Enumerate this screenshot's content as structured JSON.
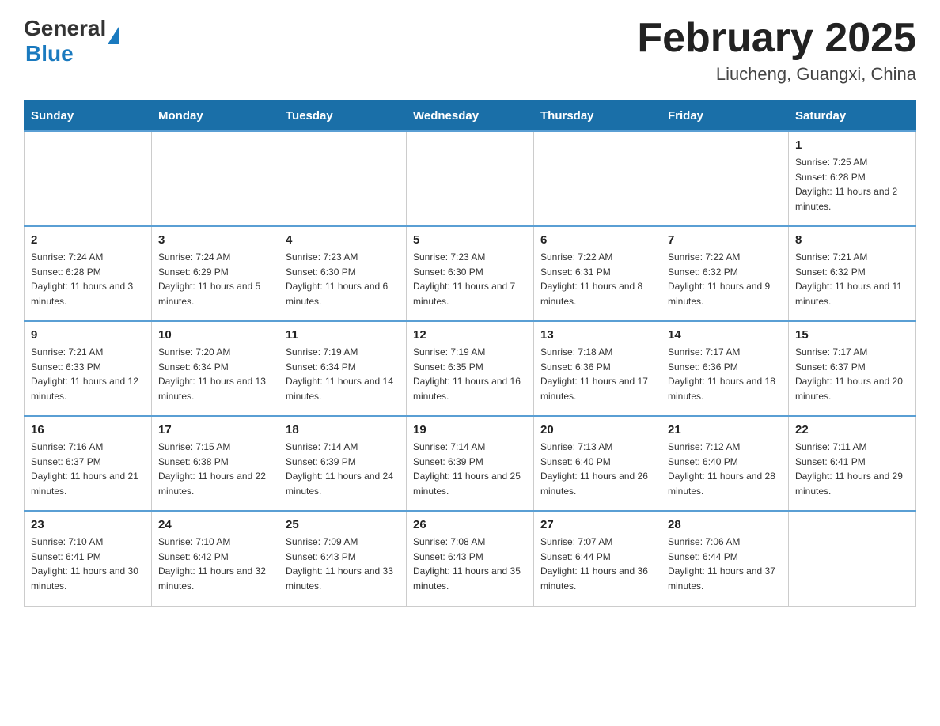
{
  "header": {
    "logo": {
      "general": "General",
      "blue": "Blue"
    },
    "title": "February 2025",
    "location": "Liucheng, Guangxi, China"
  },
  "weekdays": [
    "Sunday",
    "Monday",
    "Tuesday",
    "Wednesday",
    "Thursday",
    "Friday",
    "Saturday"
  ],
  "weeks": [
    [
      {
        "day": "",
        "info": ""
      },
      {
        "day": "",
        "info": ""
      },
      {
        "day": "",
        "info": ""
      },
      {
        "day": "",
        "info": ""
      },
      {
        "day": "",
        "info": ""
      },
      {
        "day": "",
        "info": ""
      },
      {
        "day": "1",
        "info": "Sunrise: 7:25 AM\nSunset: 6:28 PM\nDaylight: 11 hours and 2 minutes."
      }
    ],
    [
      {
        "day": "2",
        "info": "Sunrise: 7:24 AM\nSunset: 6:28 PM\nDaylight: 11 hours and 3 minutes."
      },
      {
        "day": "3",
        "info": "Sunrise: 7:24 AM\nSunset: 6:29 PM\nDaylight: 11 hours and 5 minutes."
      },
      {
        "day": "4",
        "info": "Sunrise: 7:23 AM\nSunset: 6:30 PM\nDaylight: 11 hours and 6 minutes."
      },
      {
        "day": "5",
        "info": "Sunrise: 7:23 AM\nSunset: 6:30 PM\nDaylight: 11 hours and 7 minutes."
      },
      {
        "day": "6",
        "info": "Sunrise: 7:22 AM\nSunset: 6:31 PM\nDaylight: 11 hours and 8 minutes."
      },
      {
        "day": "7",
        "info": "Sunrise: 7:22 AM\nSunset: 6:32 PM\nDaylight: 11 hours and 9 minutes."
      },
      {
        "day": "8",
        "info": "Sunrise: 7:21 AM\nSunset: 6:32 PM\nDaylight: 11 hours and 11 minutes."
      }
    ],
    [
      {
        "day": "9",
        "info": "Sunrise: 7:21 AM\nSunset: 6:33 PM\nDaylight: 11 hours and 12 minutes."
      },
      {
        "day": "10",
        "info": "Sunrise: 7:20 AM\nSunset: 6:34 PM\nDaylight: 11 hours and 13 minutes."
      },
      {
        "day": "11",
        "info": "Sunrise: 7:19 AM\nSunset: 6:34 PM\nDaylight: 11 hours and 14 minutes."
      },
      {
        "day": "12",
        "info": "Sunrise: 7:19 AM\nSunset: 6:35 PM\nDaylight: 11 hours and 16 minutes."
      },
      {
        "day": "13",
        "info": "Sunrise: 7:18 AM\nSunset: 6:36 PM\nDaylight: 11 hours and 17 minutes."
      },
      {
        "day": "14",
        "info": "Sunrise: 7:17 AM\nSunset: 6:36 PM\nDaylight: 11 hours and 18 minutes."
      },
      {
        "day": "15",
        "info": "Sunrise: 7:17 AM\nSunset: 6:37 PM\nDaylight: 11 hours and 20 minutes."
      }
    ],
    [
      {
        "day": "16",
        "info": "Sunrise: 7:16 AM\nSunset: 6:37 PM\nDaylight: 11 hours and 21 minutes."
      },
      {
        "day": "17",
        "info": "Sunrise: 7:15 AM\nSunset: 6:38 PM\nDaylight: 11 hours and 22 minutes."
      },
      {
        "day": "18",
        "info": "Sunrise: 7:14 AM\nSunset: 6:39 PM\nDaylight: 11 hours and 24 minutes."
      },
      {
        "day": "19",
        "info": "Sunrise: 7:14 AM\nSunset: 6:39 PM\nDaylight: 11 hours and 25 minutes."
      },
      {
        "day": "20",
        "info": "Sunrise: 7:13 AM\nSunset: 6:40 PM\nDaylight: 11 hours and 26 minutes."
      },
      {
        "day": "21",
        "info": "Sunrise: 7:12 AM\nSunset: 6:40 PM\nDaylight: 11 hours and 28 minutes."
      },
      {
        "day": "22",
        "info": "Sunrise: 7:11 AM\nSunset: 6:41 PM\nDaylight: 11 hours and 29 minutes."
      }
    ],
    [
      {
        "day": "23",
        "info": "Sunrise: 7:10 AM\nSunset: 6:41 PM\nDaylight: 11 hours and 30 minutes."
      },
      {
        "day": "24",
        "info": "Sunrise: 7:10 AM\nSunset: 6:42 PM\nDaylight: 11 hours and 32 minutes."
      },
      {
        "day": "25",
        "info": "Sunrise: 7:09 AM\nSunset: 6:43 PM\nDaylight: 11 hours and 33 minutes."
      },
      {
        "day": "26",
        "info": "Sunrise: 7:08 AM\nSunset: 6:43 PM\nDaylight: 11 hours and 35 minutes."
      },
      {
        "day": "27",
        "info": "Sunrise: 7:07 AM\nSunset: 6:44 PM\nDaylight: 11 hours and 36 minutes."
      },
      {
        "day": "28",
        "info": "Sunrise: 7:06 AM\nSunset: 6:44 PM\nDaylight: 11 hours and 37 minutes."
      },
      {
        "day": "",
        "info": ""
      }
    ]
  ]
}
